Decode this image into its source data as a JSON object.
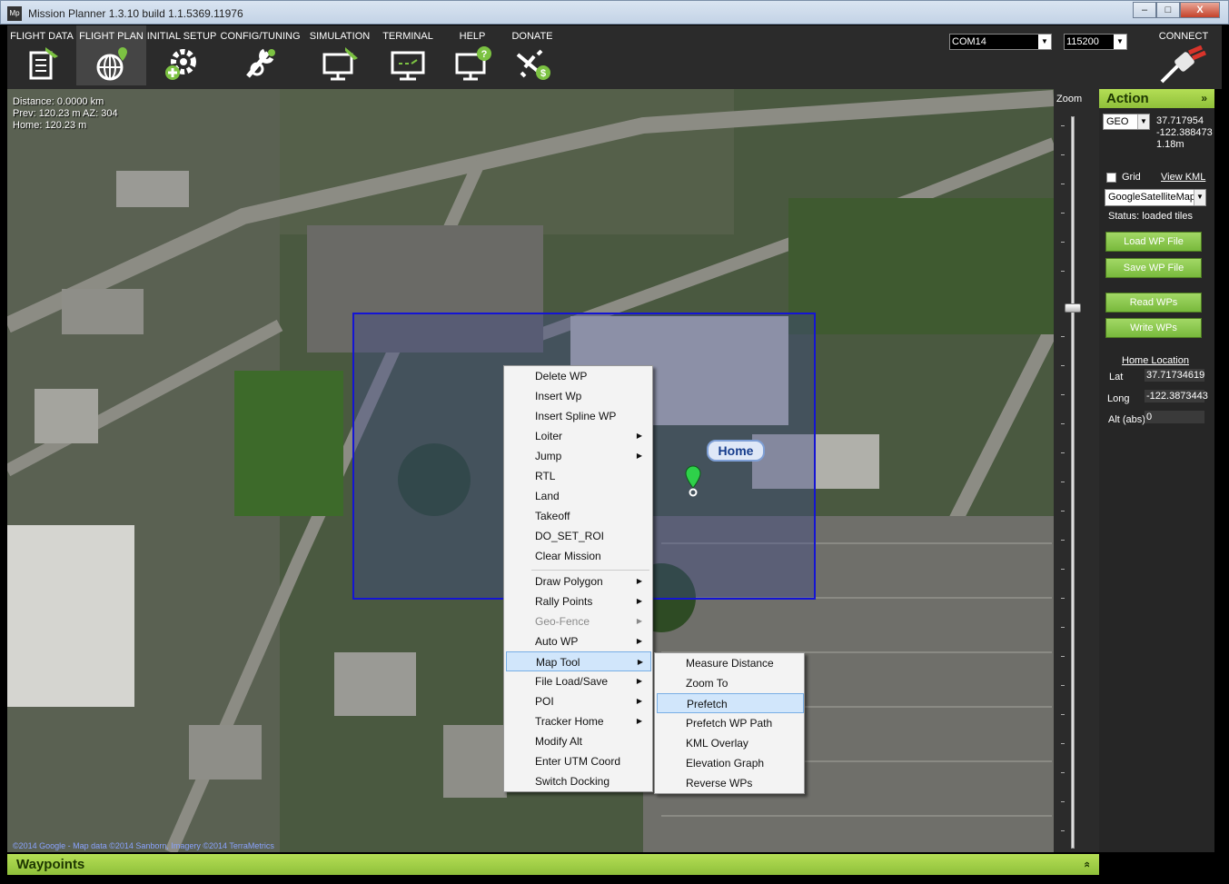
{
  "window": {
    "title": "Mission Planner 1.3.10 build 1.1.5369.11976",
    "app_icon": "Mp",
    "min": "–",
    "max": "□",
    "close": "X"
  },
  "toolbar": {
    "tabs": [
      {
        "label": "FLIGHT DATA",
        "icon": "flight-data-icon"
      },
      {
        "label": "FLIGHT PLAN",
        "icon": "flight-plan-icon",
        "active": true
      },
      {
        "label": "INITIAL SETUP",
        "icon": "initial-setup-icon"
      },
      {
        "label": "CONFIG/TUNING",
        "icon": "config-tuning-icon"
      },
      {
        "label": "SIMULATION",
        "icon": "simulation-icon"
      },
      {
        "label": "TERMINAL",
        "icon": "terminal-icon"
      },
      {
        "label": "HELP",
        "icon": "help-icon"
      },
      {
        "label": "DONATE",
        "icon": "donate-icon"
      }
    ],
    "port": "COM14",
    "baud": "115200",
    "connect_label": "CONNECT"
  },
  "map": {
    "distance": "Distance: 0.0000 km",
    "prev": "Prev: 120.23 m AZ: 304",
    "home": "Home: 120.23 m",
    "home_label": "Home",
    "copyright": "©2014 Google - Map data ©2014 Sanborn, Imagery ©2014 TerraMetrics"
  },
  "zoom": {
    "label": "Zoom"
  },
  "action": {
    "title": "Action",
    "chevron": "»",
    "coord_type": "GEO",
    "lat": "37.717954",
    "lng": "-122.388473",
    "alt": "1.18m",
    "grid_label": "Grid",
    "view_kml": "View KML",
    "map_type": "GoogleSatelliteMap",
    "status": "Status: loaded tiles",
    "load_wp": "Load WP File",
    "save_wp": "Save WP File",
    "read_wps": "Read WPs",
    "write_wps": "Write WPs",
    "home_location": "Home Location",
    "lat_label": "Lat",
    "lat_value": "37.71734619",
    "long_label": "Long",
    "long_value": "-122.3873443",
    "alt_label": "Alt (abs)",
    "alt_value": "0"
  },
  "waypoints": {
    "title": "Waypoints",
    "chevron": "»"
  },
  "context_menu": {
    "items": [
      "Delete WP",
      "Insert Wp",
      "Insert Spline WP",
      "Loiter",
      "Jump",
      "RTL",
      "Land",
      "Takeoff",
      "DO_SET_ROI",
      "Clear Mission",
      "Draw Polygon",
      "Rally Points",
      "Geo-Fence",
      "Auto WP",
      "Map Tool",
      "File Load/Save",
      "POI",
      "Tracker Home",
      "Modify Alt",
      "Enter UTM Coord",
      "Switch Docking"
    ],
    "submenu_arrow": "▶"
  },
  "submenu": {
    "items": [
      "Measure Distance",
      "Zoom To",
      "Prefetch",
      "Prefetch WP Path",
      "KML Overlay",
      "Elevation Graph",
      "Reverse WPs"
    ]
  }
}
